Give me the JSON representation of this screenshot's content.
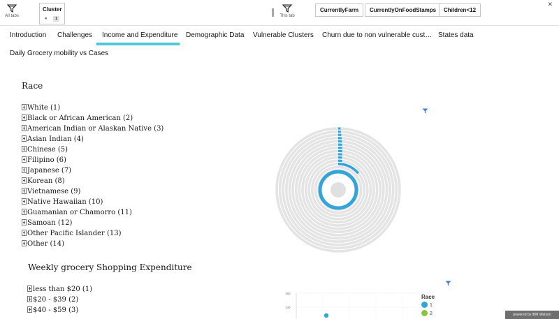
{
  "filter_bar": {
    "all_tabs": {
      "label": "All tabs",
      "icon": "funnel-icon"
    },
    "cluster_filter": {
      "title": "Cluster",
      "values": [
        "4",
        "1"
      ],
      "selected": "1"
    },
    "this_tab": {
      "label": "This tab",
      "icon": "funnel-icon"
    },
    "chips": [
      "CurrentlyFarm",
      "CurrentlyOnFoodStamps",
      "Children<12"
    ]
  },
  "tabs": [
    "Introduction",
    "Challenges",
    "Income and Expenditure",
    "Demographic Data",
    "Vulnerable Clusters",
    "Churn due to non vulnerable cust…",
    "States data",
    "Daily Grocery mobility vs Cases"
  ],
  "active_tab": "Income and Expenditure",
  "race_section": {
    "title": "Race",
    "items": [
      "White (1)",
      "Black or African American (2)",
      "American Indian or Alaskan Native (3)",
      "Asian Indian (4)",
      "Chinese (5)",
      "Filipino (6)",
      "Japanese (7)",
      "Korean (8)",
      "Vietnamese (9)",
      "Native Hawaiian (10)",
      "Guamanian or Chamorro (11)",
      "Samoan (12)",
      "Other Pacific Islander (13)",
      "Other (14)"
    ]
  },
  "expenditure_section": {
    "title": "Weekly grocery Shopping Expenditure",
    "items": [
      "less than $20 (1)",
      "$20 - $39 (2)",
      "$40 - $59 (3)"
    ]
  },
  "radial_chart": {
    "accent_color": "#34a4d8",
    "track_color": "#e4e4e4",
    "ring_count": 14,
    "highlight_fraction": 0.14
  },
  "chart_data": {
    "type": "scatter",
    "y_ticks": [
      "160",
      "140"
    ],
    "legend_title": "Race",
    "series": [
      {
        "name": "1",
        "color": "#2ea7d9"
      },
      {
        "name": "2",
        "color": "#8ac43f"
      }
    ]
  },
  "footer": {
    "watson_label": "powered by IBM Watson"
  },
  "colors": {
    "accent": "#4ec8d6",
    "filter_icon": "#3d7fd9"
  }
}
